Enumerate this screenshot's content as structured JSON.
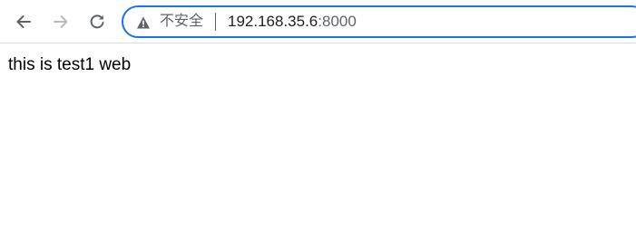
{
  "browser": {
    "security_label": "不安全",
    "url_host": "192.168.35.6",
    "url_port": ":8000",
    "icons": {
      "back": "back-arrow-icon",
      "forward": "forward-arrow-icon",
      "reload": "reload-icon",
      "security": "warning-triangle-icon"
    },
    "accent_color": "#1a73e8"
  },
  "page": {
    "body_text": "this is test1 web"
  }
}
